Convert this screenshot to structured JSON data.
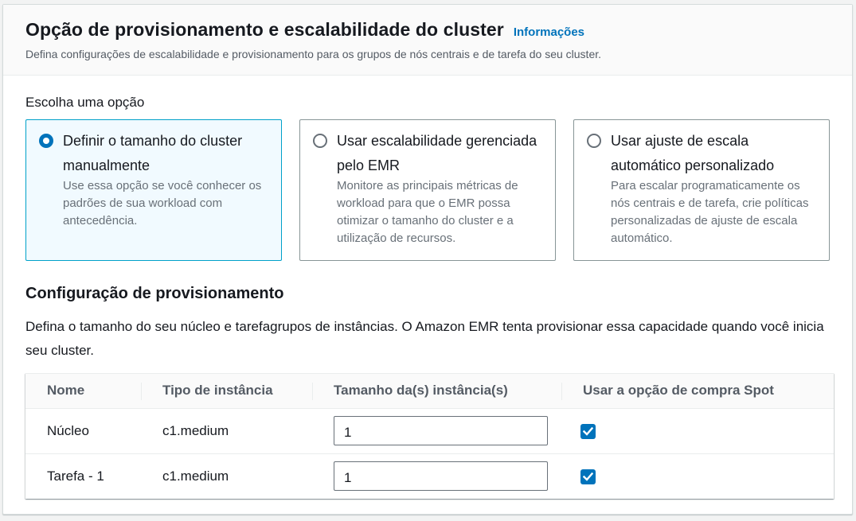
{
  "header": {
    "title": "Opção de provisionamento e escalabilidade do cluster",
    "info_link": "Informações",
    "description": "Defina configurações de escalabilidade e provisionamento para os grupos de nós centrais e de tarefa do seu cluster."
  },
  "options": {
    "label": "Escolha uma opção",
    "tiles": [
      {
        "label": "Definir o tamanho do cluster manualmente",
        "description": "Use essa opção se você conhecer os padrões de sua workload com antecedência.",
        "selected": true
      },
      {
        "label": "Usar escalabilidade gerenciada pelo EMR",
        "description": "Monitore as principais métricas de workload para que o EMR possa otimizar o tamanho do cluster e a utilização de recursos.",
        "selected": false
      },
      {
        "label": "Usar ajuste de escala automático personalizado",
        "description": "Para escalar programaticamente os nós centrais e de tarefa, crie políticas personalizadas de ajuste de escala automático.",
        "selected": false
      }
    ]
  },
  "provisioning": {
    "title": "Configuração de provisionamento",
    "description": "Defina o tamanho do seu núcleo e tarefagrupos de instâncias. O Amazon EMR tenta provisionar essa capacidade quando você inicia seu cluster.",
    "columns": [
      "Nome",
      "Tipo de instância",
      "Tamanho da(s) instância(s)",
      "Usar a opção de compra Spot"
    ],
    "rows": [
      {
        "name": "Núcleo",
        "instance_type": "c1.medium",
        "size": "1",
        "spot": true
      },
      {
        "name": "Tarefa - 1",
        "instance_type": "c1.medium",
        "size": "1",
        "spot": true
      }
    ]
  },
  "colors": {
    "accent": "#0073bb",
    "selected_tile_bg": "#f1faff",
    "selected_tile_border": "#00a1c9"
  },
  "icons": {
    "radio_selected": "radio-selected-icon",
    "radio_unselected": "radio-unselected-icon",
    "checkbox_checked": "checkmark-icon"
  }
}
